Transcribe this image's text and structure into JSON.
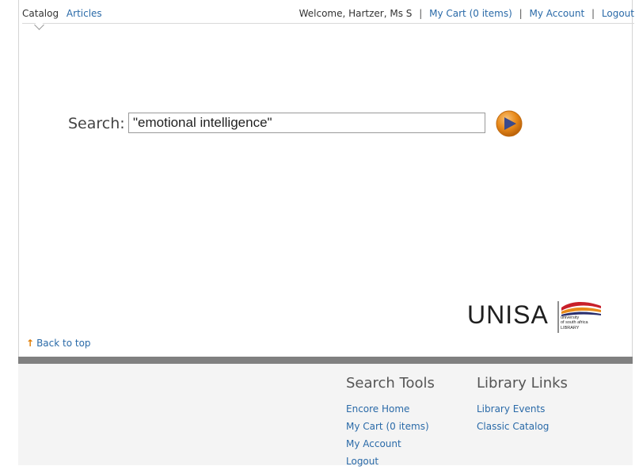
{
  "nav": {
    "tabs": [
      {
        "label": "Catalog",
        "active": true
      },
      {
        "label": "Articles",
        "active": false
      }
    ]
  },
  "userbar": {
    "welcome": "Welcome, Hartzer, Ms S",
    "cart": "My Cart (0 items)",
    "account": "My Account",
    "logout": "Logout",
    "separator": "|"
  },
  "search": {
    "label": "Search:",
    "value": "\"emotional intelligence\"",
    "button_icon": "play-arrow-icon",
    "button_color": "#e88a1a"
  },
  "logo": {
    "name": "UNISA",
    "small_text": [
      "university",
      "of south africa",
      "LIBRARY"
    ]
  },
  "back_to_top": {
    "label": "Back to top",
    "icon": "up-arrow-icon"
  },
  "footer": {
    "search_tools": {
      "title": "Search Tools",
      "links": [
        "Encore Home",
        "My Cart (0 items)",
        "My Account",
        "Logout"
      ]
    },
    "library_links": {
      "title": "Library Links",
      "links": [
        "Library Events",
        "Classic Catalog"
      ]
    }
  },
  "colors": {
    "link": "#2a6aa8",
    "accent": "#e88a1a",
    "divider": "#808080",
    "footer_bg": "#f4f4f4"
  }
}
